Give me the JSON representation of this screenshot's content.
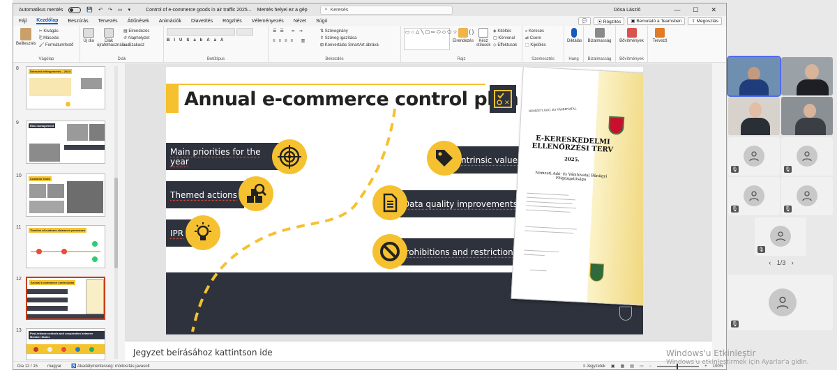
{
  "titlebar": {
    "autosave_label": "Automatikus mentés",
    "doc_title": "Control of e-commerce goods in air traffic 2025...",
    "save_status": "Mentés helyei ez a gép",
    "search_placeholder": "Keresés",
    "user_name": "Dósa László",
    "minimize": "—",
    "maximize": "☐",
    "close": "✕"
  },
  "menu": {
    "tabs": [
      "Fájl",
      "Kezdőlap",
      "Beszúrás",
      "Tervezés",
      "Áttűnések",
      "Animációk",
      "Diavetítés",
      "Rögzítés",
      "Véleményezés",
      "Nézet",
      "Súgó"
    ],
    "active_tab": "Kezdőlap",
    "comment_button": "💬",
    "record_button": "⦿ Rögzítés",
    "teams_button": "▣ Bemutató a Teamsben",
    "share_button": "⇪ Megosztás"
  },
  "ribbon": {
    "groups": {
      "clipboard": {
        "label": "Vágólap",
        "paste": "Beillesztés",
        "cut": "Kivágás",
        "copy": "Másolás",
        "format": "Formátumfestő"
      },
      "slides": {
        "label": "Diák",
        "new": "Új dia",
        "reuse": "Diák újrafelhasználása",
        "layout": "Elrendezés",
        "reset": "Alaphelyzet",
        "section": "Szakasz"
      },
      "font": {
        "label": "Betűtípus"
      },
      "paragraph": {
        "label": "Bekezdés",
        "text_direction": "Szövegirány",
        "align_text": "Szöveg igazítása",
        "smartart": "Konvertálás SmartArt ábrává"
      },
      "drawing": {
        "label": "Rajz",
        "arrange": "Elrendezés",
        "quick_styles": "Kész stílusok",
        "fill": "Kitöltés",
        "outline": "Körvonal",
        "effects": "Effektusok"
      },
      "editing": {
        "label": "Szerkesztés",
        "find": "Keresés",
        "replace": "Csere",
        "select": "Kijelölés"
      },
      "voice": {
        "label": "Hang",
        "dictate": "Diktálás"
      },
      "sensitivity": {
        "label": "Bizalmasság",
        "name": "Bizalmasság"
      },
      "addins": {
        "label": "Bővítmények",
        "name": "Bővítmények"
      },
      "designer": {
        "label": "",
        "name": "Tervező"
      }
    }
  },
  "thumbnails": [
    {
      "num": "8",
      "title": "Detected infringements – 2024"
    },
    {
      "num": "9",
      "title": "Risk management"
    },
    {
      "num": "10",
      "title": "Customs' tools"
    },
    {
      "num": "11",
      "title": "Timeline of customs clearance processes"
    },
    {
      "num": "12",
      "title": "Annual e-commerce control plan"
    },
    {
      "num": "13",
      "title": "Post-release controls and cooperation between Member States"
    }
  ],
  "slide": {
    "title": "Annual e-commerce control plan",
    "items": {
      "priorities": "Main priorities for the year",
      "themed": "Themed actions",
      "ipr": "IPR",
      "intrinsic": "Intrinsic value",
      "quality": "Data quality improvements",
      "prohibitions": "Prohibitions and restrictions"
    },
    "document": {
      "header": "NEMZETI ADÓ- ÉS VÁMHIVATAL",
      "title": "E-KERESKEDELMI ELLENŐRZÉSI TERV",
      "year": "2025.",
      "org": "Nemzeti Adó- és Vámhivatal Bűnügyi Főigazgatósága"
    },
    "colors": {
      "yellow": "#f6c130",
      "dark": "#2e323d"
    }
  },
  "notes": {
    "placeholder": "Jegyzet beírásához kattintson ide"
  },
  "status": {
    "slide_count": "Dia 12 / 15",
    "language": "magyar",
    "accessibility": "Akadálymentesség: módosítás javasolt",
    "notes": "Jegyzetek",
    "zoom": "100%"
  },
  "gallery": {
    "page": "1/3",
    "prev": "‹",
    "next": "›"
  },
  "watermark": {
    "line1": "Windows'u Etkinleştir",
    "line2": "Windows'u etkinleştirmek için Ayarlar'a gidin."
  }
}
